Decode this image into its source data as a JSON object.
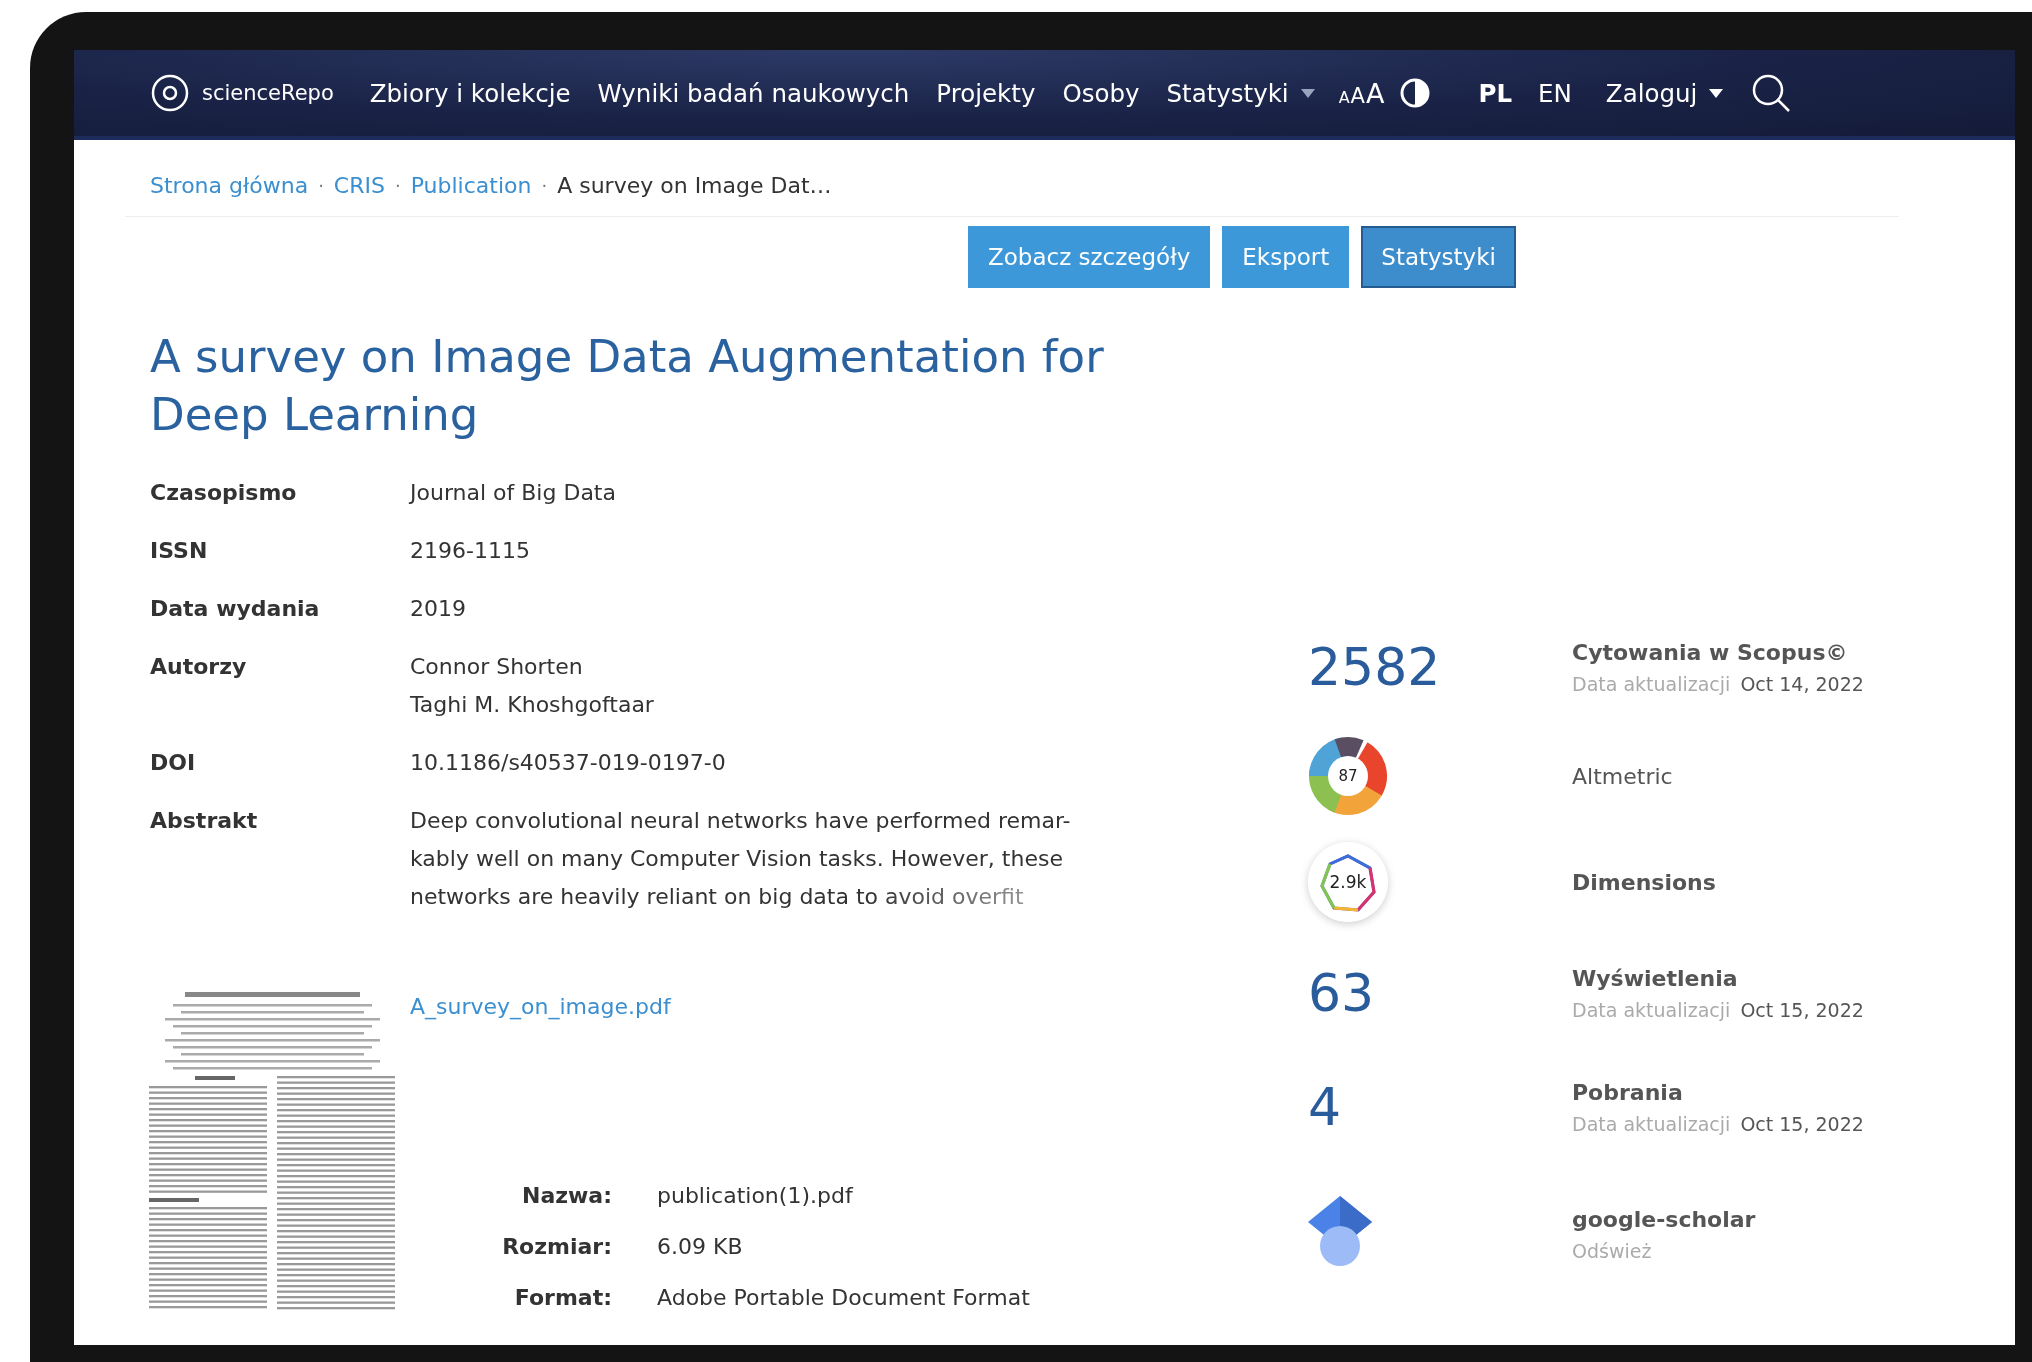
{
  "header": {
    "logo": "scienceRepo",
    "nav": [
      {
        "label": "Zbiory i kolekcje",
        "dropdown": false
      },
      {
        "label": "Wyniki badań naukowych",
        "dropdown": false
      },
      {
        "label": "Projekty",
        "dropdown": false
      },
      {
        "label": "Osoby",
        "dropdown": false
      },
      {
        "label": "Statystyki",
        "dropdown": true
      }
    ],
    "font_sizes": [
      "A",
      "A",
      "A"
    ],
    "languages": [
      {
        "label": "PL",
        "selected": true
      },
      {
        "label": "EN",
        "selected": false
      }
    ],
    "login": "Zaloguj"
  },
  "breadcrumb_separator": "·",
  "breadcrumb": [
    {
      "label": "Strona główna",
      "link": true
    },
    {
      "label": "CRIS",
      "link": true
    },
    {
      "label": "Publication",
      "link": true
    },
    {
      "label": "A survey on Image Dat…",
      "link": false
    }
  ],
  "actions": [
    {
      "label": "Zobacz szczegóły",
      "selected": false
    },
    {
      "label": "Eksport",
      "selected": false
    },
    {
      "label": "Statystyki",
      "selected": true
    }
  ],
  "title": "A survey on Image Data Augmentation for Deep Learning",
  "fields": [
    {
      "kind": "text",
      "label": "Czasopismo",
      "values": [
        "Journal of Big Data"
      ]
    },
    {
      "kind": "text",
      "label": "ISSN",
      "values": [
        "2196-1115"
      ]
    },
    {
      "kind": "text",
      "label": "Data wydania",
      "values": [
        "2019"
      ]
    },
    {
      "kind": "text",
      "label": "Autorzy",
      "values": [
        "Connor Shorten",
        "Taghi M. Khoshgoftaar"
      ]
    },
    {
      "kind": "text",
      "label": "DOI",
      "values": [
        "10.1186/s40537-019-0197-0"
      ]
    },
    {
      "kind": "abstract",
      "label": "Abstrakt",
      "values": [
        "Deep convolutional neural networks have performed remar-",
        "kably well on many Computer Vision tasks. However, these",
        "networks are heavily reliant on big data to avoid overfit"
      ]
    }
  ],
  "file": {
    "link": "A_survey_on_image.pdf",
    "details": [
      {
        "label": "Nazwa:",
        "value": "publication(1).pdf"
      },
      {
        "label": "Rozmiar:",
        "value": "6.09 KB"
      },
      {
        "label": "Format:",
        "value": "Adobe Portable Document Format"
      }
    ]
  },
  "metrics": [
    {
      "kind": "number",
      "value": "2582",
      "label": "Cytowania w Scopus©",
      "label_bold": true,
      "date_label": "Data aktualizacji",
      "date": "Oct 14, 2022"
    },
    {
      "kind": "altmetric",
      "value": "87",
      "label": "Altmetric",
      "label_bold": false
    },
    {
      "kind": "dimensions",
      "value": "2.9k",
      "label": "Dimensions",
      "label_bold": true
    },
    {
      "kind": "number",
      "value": "63",
      "label": "Wyświetlenia",
      "label_bold": true,
      "date_label": "Data aktualizacji",
      "date": "Oct 15, 2022"
    },
    {
      "kind": "number",
      "value": "4",
      "label": "Pobrania",
      "label_bold": true,
      "date_label": "Data aktualizacji",
      "date": "Oct 15, 2022"
    },
    {
      "kind": "scholar",
      "label": "google-scholar",
      "label_bold": true,
      "link": "Odśwież"
    }
  ]
}
